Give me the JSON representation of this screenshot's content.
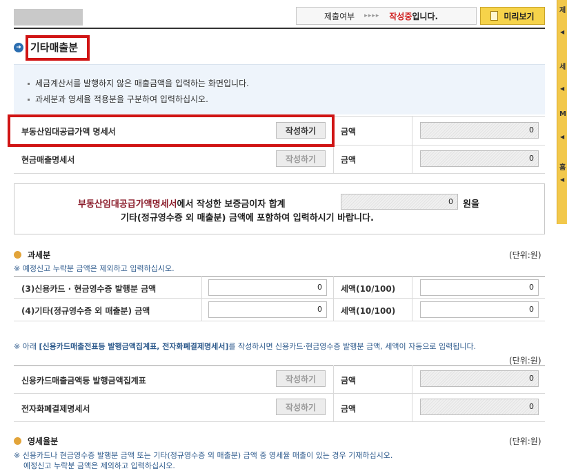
{
  "status": {
    "label": "제출여부",
    "arrows": "▸▸▸▸",
    "value": "작성중",
    "suffix": "입니다."
  },
  "preview_label": "미리보기",
  "right_panel": [
    "제",
    "세",
    "M",
    "홈"
  ],
  "section_title": "기타매출분",
  "info": [
    "세금계산서를 발행하지 않은 매출금액을 입력하는 화면입니다.",
    "과세분과 영세율 적용분을 구분하여 입력하십시오."
  ],
  "rows1": [
    {
      "label": "부동산임대공급가액 명세서",
      "button": "작성하기",
      "amount_label": "금액",
      "amount": "0"
    },
    {
      "label": "현금매출명세서",
      "button": "작성하기",
      "amount_label": "금액",
      "amount": "0"
    }
  ],
  "notice": {
    "hl": "부동산임대공급가액명세서",
    "t1": "에서 작성한 보증금이자 합계",
    "value": "0",
    "t2": "원을",
    "line2": "기타(정규영수증 외 매출분) 금액에 포함하여 입력하시기 바랍니다."
  },
  "taxable": {
    "title": "과세분",
    "unit": "(단위:원)",
    "note": "※ 예정신고 누락분 금액은 제외하고 입력하십시오.",
    "rows": [
      {
        "label": "(3)신용카드 · 현금영수증 발행분 금액",
        "value": "0",
        "tax_label": "세액(10/100)",
        "tax": "0"
      },
      {
        "label": "(4)기타(정규영수증 외 매출분) 금액",
        "value": "0",
        "tax_label": "세액(10/100)",
        "tax": "0"
      }
    ]
  },
  "auto_note": {
    "pre": "※ 아래 ",
    "bold": "[신용카드매출전표등 발행금액집계표, 전자화폐결제명세서]",
    "post": "를 작성하시면 신용카드·현금영수증 발행분 금액, 세액이 자동으로 입력됩니다."
  },
  "unit2": "(단위:원)",
  "rows2": [
    {
      "label": "신용카드매출금액등 발행금액집계표",
      "button": "작성하기",
      "amount_label": "금액",
      "amount": "0"
    },
    {
      "label": "전자화폐결제명세서",
      "button": "작성하기",
      "amount_label": "금액",
      "amount": "0"
    }
  ],
  "zero_rate": {
    "title": "영세율분",
    "unit": "(단위:원)",
    "note1": "※ 신용카드나 현금영수증 발행분 금액 또는 기타(정규영수증 외 매출분) 금액 중 영세율 매출이 있는 경우 기재하십시오.",
    "note2": "예정신고 누락분 금액은 제외하고 입력하십시오."
  }
}
